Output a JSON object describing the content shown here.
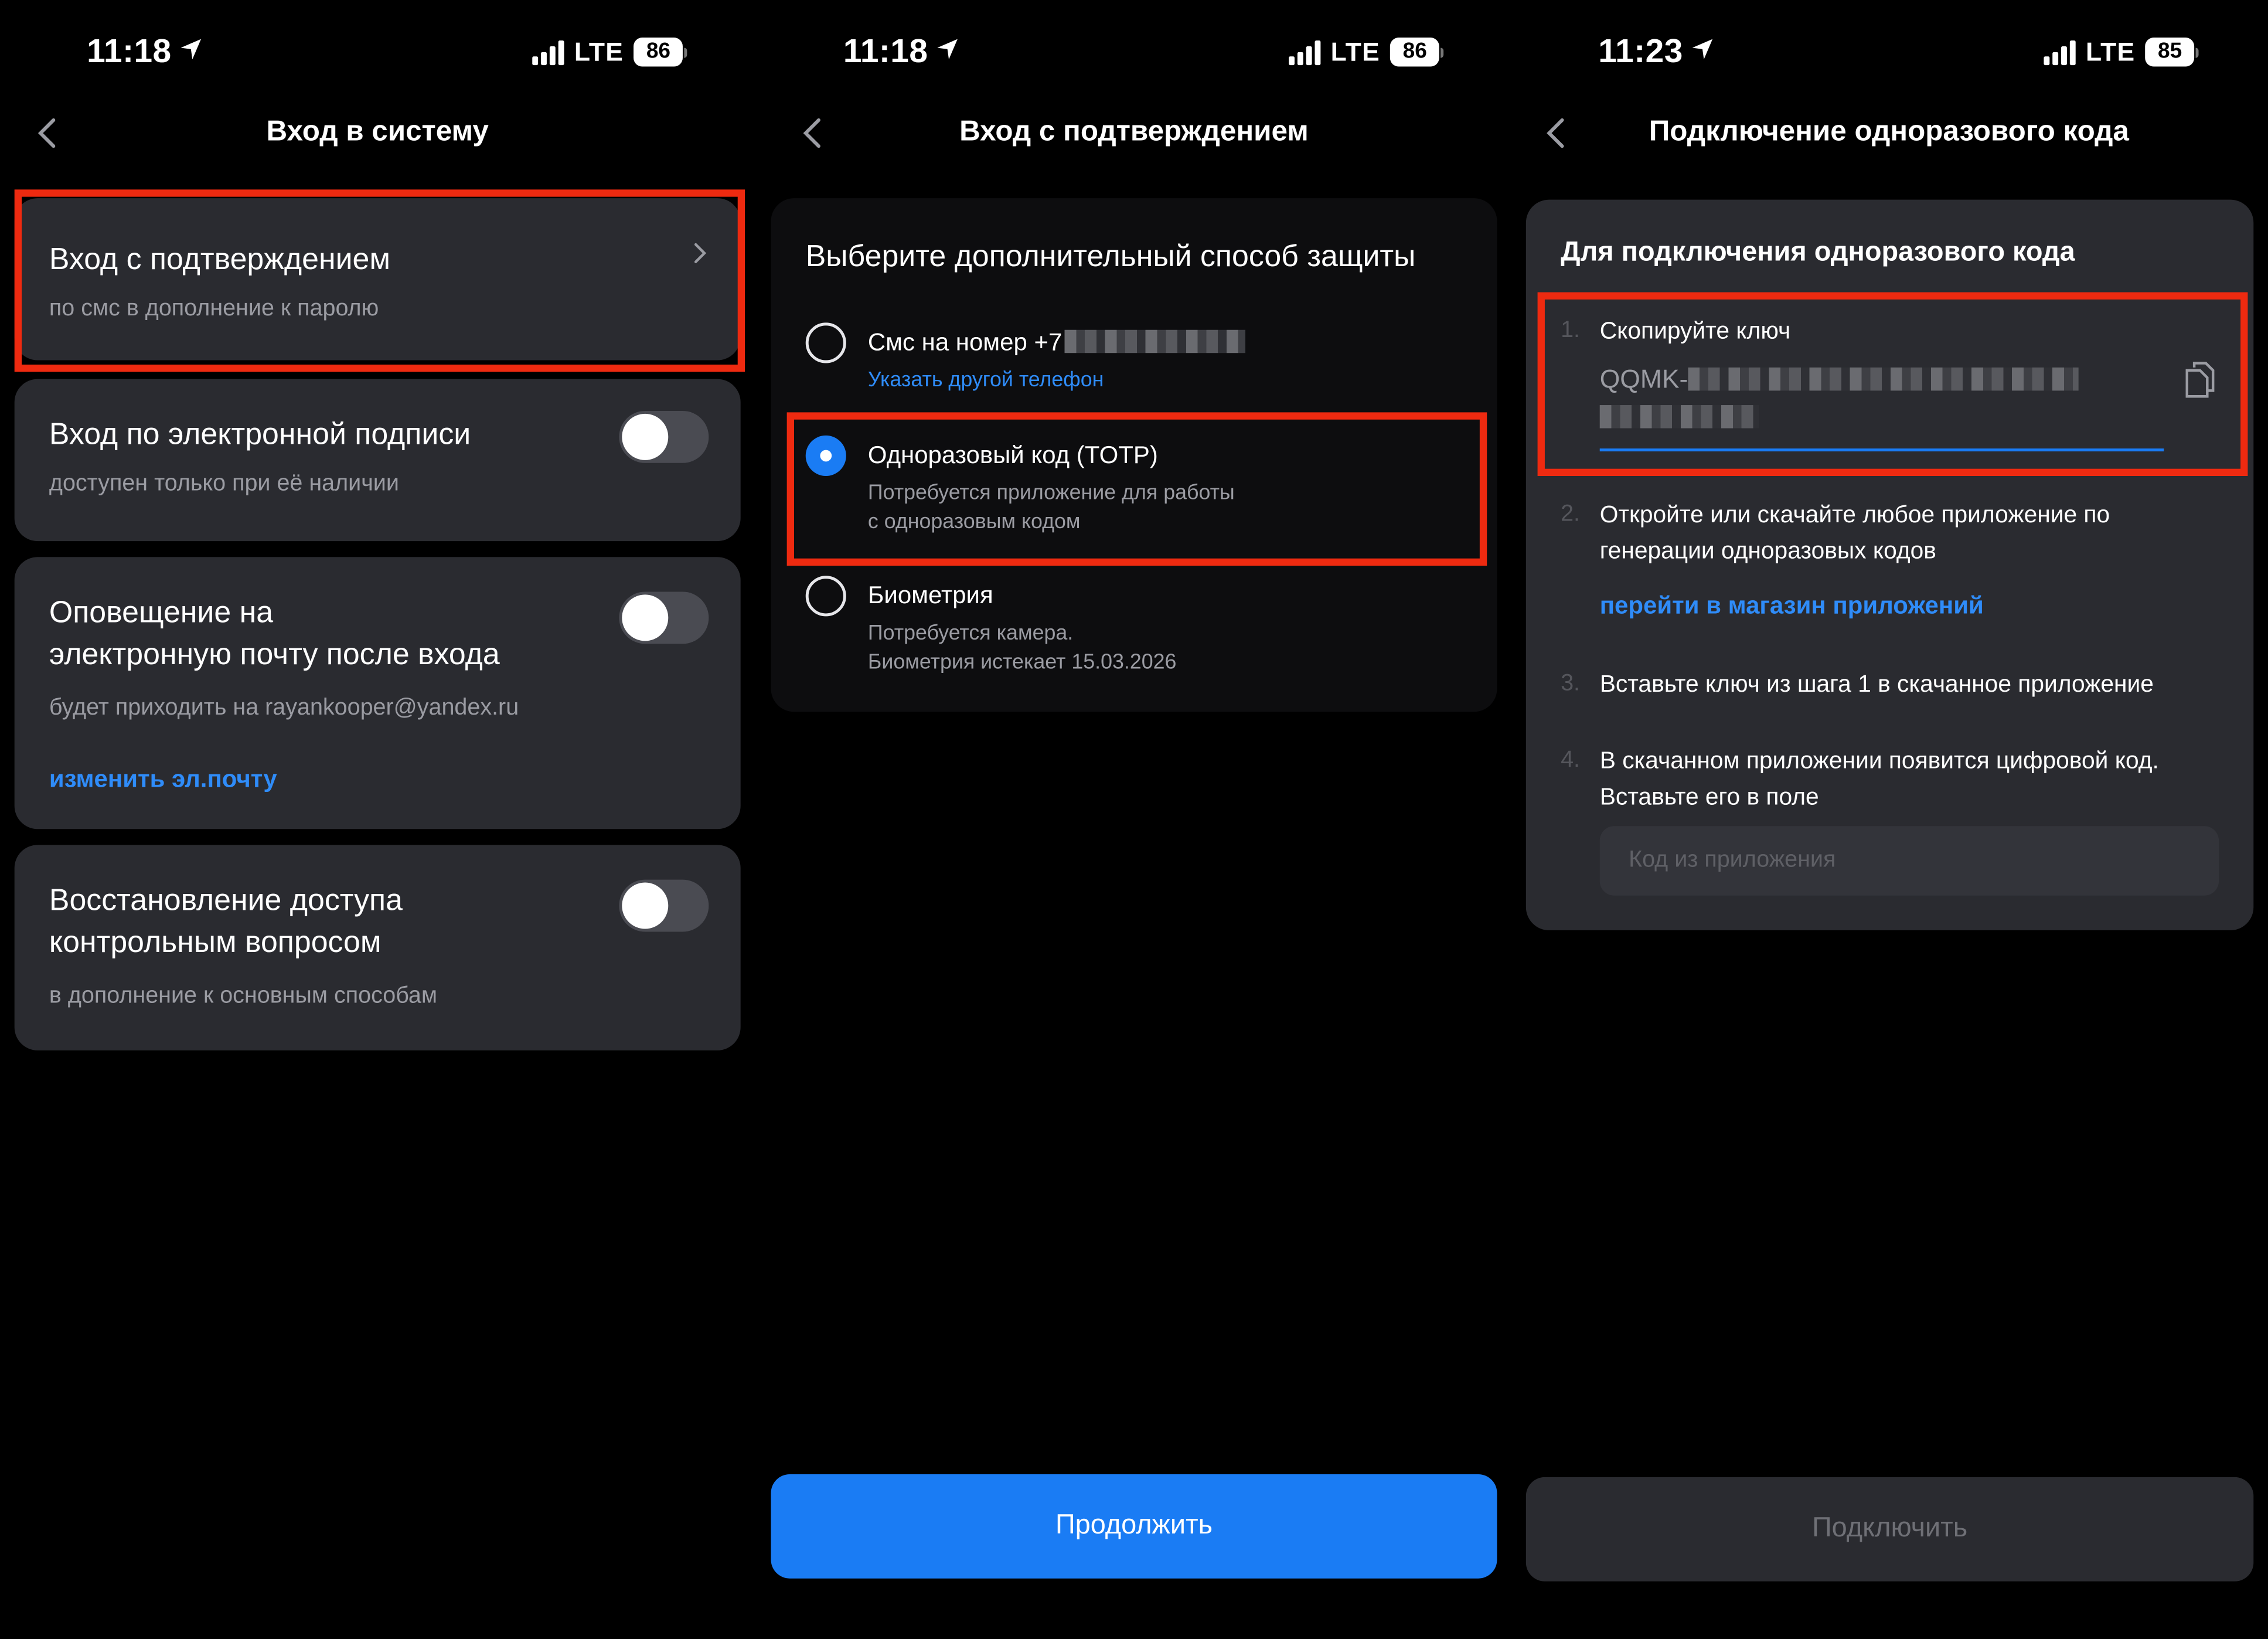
{
  "status_left": {
    "time": "11:18",
    "network": "LTE",
    "battery": "86"
  },
  "status_middle": {
    "time": "11:18",
    "network": "LTE",
    "battery": "86"
  },
  "status_right": {
    "time": "11:23",
    "network": "LTE",
    "battery": "85"
  },
  "login": {
    "title": "Вход в систему",
    "confirm": {
      "title": "Вход с подтверждением",
      "subtitle": "по смс в дополнение к паролю"
    },
    "esign": {
      "title": "Вход по электронной подписи",
      "subtitle": "доступен только при её наличии",
      "enabled": false
    },
    "notify": {
      "title_line1": "Оповещение на",
      "title_line2": "электронную почту после входа",
      "subtitle": "будет приходить на rayankooper@yandex.ru",
      "link": "изменить эл.почту",
      "enabled": false
    },
    "recovery": {
      "title_line1": "Восстановление доступа",
      "title_line2": "контрольным вопросом",
      "subtitle": "в дополнение к основным способам",
      "enabled": false
    }
  },
  "confirm_screen": {
    "title": "Вход с подтверждением",
    "heading": "Выберите дополнительный способ защиты",
    "options": [
      {
        "label": "Смс на номер +7",
        "link": "Указать другой телефон",
        "selected": false
      },
      {
        "label": "Одноразовый код (TOTP)",
        "desc_line1": "Потребуется приложение для работы",
        "desc_line2": "с одноразовым кодом",
        "selected": true
      },
      {
        "label": "Биометрия",
        "desc_line1": "Потребуется камера.",
        "desc_line2": "Биометрия истекает 15.03.2026",
        "selected": false
      }
    ],
    "continue_label": "Продолжить"
  },
  "otp_screen": {
    "title": "Подключение одноразового кода",
    "heading": "Для подключения одноразового кода",
    "steps": [
      {
        "num": "1.",
        "text": "Скопируйте ключ",
        "key_prefix": "QQMK-"
      },
      {
        "num": "2.",
        "text_line1": "Откройте или скачайте любое приложение по",
        "text_line2": "генерации одноразовых кодов",
        "link": "перейти в магазин приложений"
      },
      {
        "num": "3.",
        "text": "Вставьте ключ из шага 1 в скачанное приложение"
      },
      {
        "num": "4.",
        "text_line1": "В скачанном приложении появится цифровой код.",
        "text_line2": "Вставьте его в поле",
        "placeholder": "Код из приложения"
      }
    ],
    "connect_label": "Подключить"
  },
  "colors": {
    "accent": "#1a7cf4",
    "highlight": "#ee2a10",
    "card": "#2a2b30",
    "background": "#000000"
  }
}
